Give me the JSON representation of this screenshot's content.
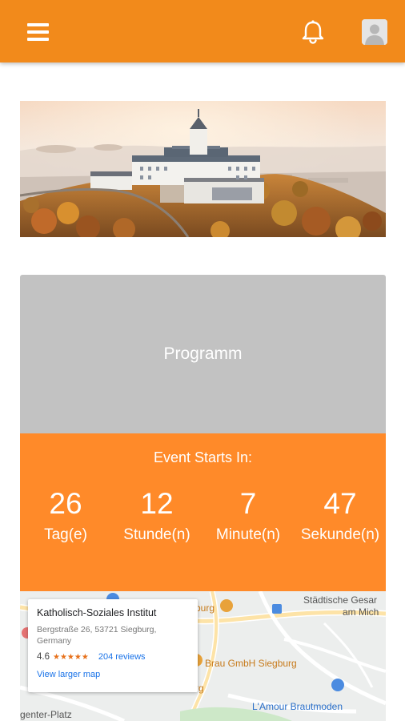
{
  "colors": {
    "app_bar": "#f28a1b",
    "countdown_bg": "#ff8a29",
    "programm_bg": "#c2c2c2"
  },
  "app_bar": {
    "menu_icon": "hamburger-menu-icon",
    "notification_icon": "bell-icon",
    "profile_icon": "avatar-icon"
  },
  "programm": {
    "label": "Programm"
  },
  "countdown": {
    "heading": "Event Starts In:",
    "days": {
      "value": "26",
      "unit": "Tag(e)"
    },
    "hours": {
      "value": "12",
      "unit": "Stunde(n)"
    },
    "minutes": {
      "value": "7",
      "unit": "Minute(n)"
    },
    "seconds": {
      "value": "47",
      "unit": "Sekunde(n)"
    }
  },
  "map": {
    "place_name": "Katholisch-Soziales Institut",
    "address": "Bergstraße 26, 53721 Siegburg, Germany",
    "rating": "4.6",
    "stars": "★★★★★",
    "reviews": "204 reviews",
    "larger_map": "View larger map",
    "labels": {
      "stadtische": "Städtische Gesar",
      "am_mich": "am Mich",
      "burg": "burg",
      "brau": "Brau GmbH Siegburg",
      "rg": "rg",
      "lamour": "L'Amour Brautmoden",
      "platz": "genter-Platz"
    }
  }
}
